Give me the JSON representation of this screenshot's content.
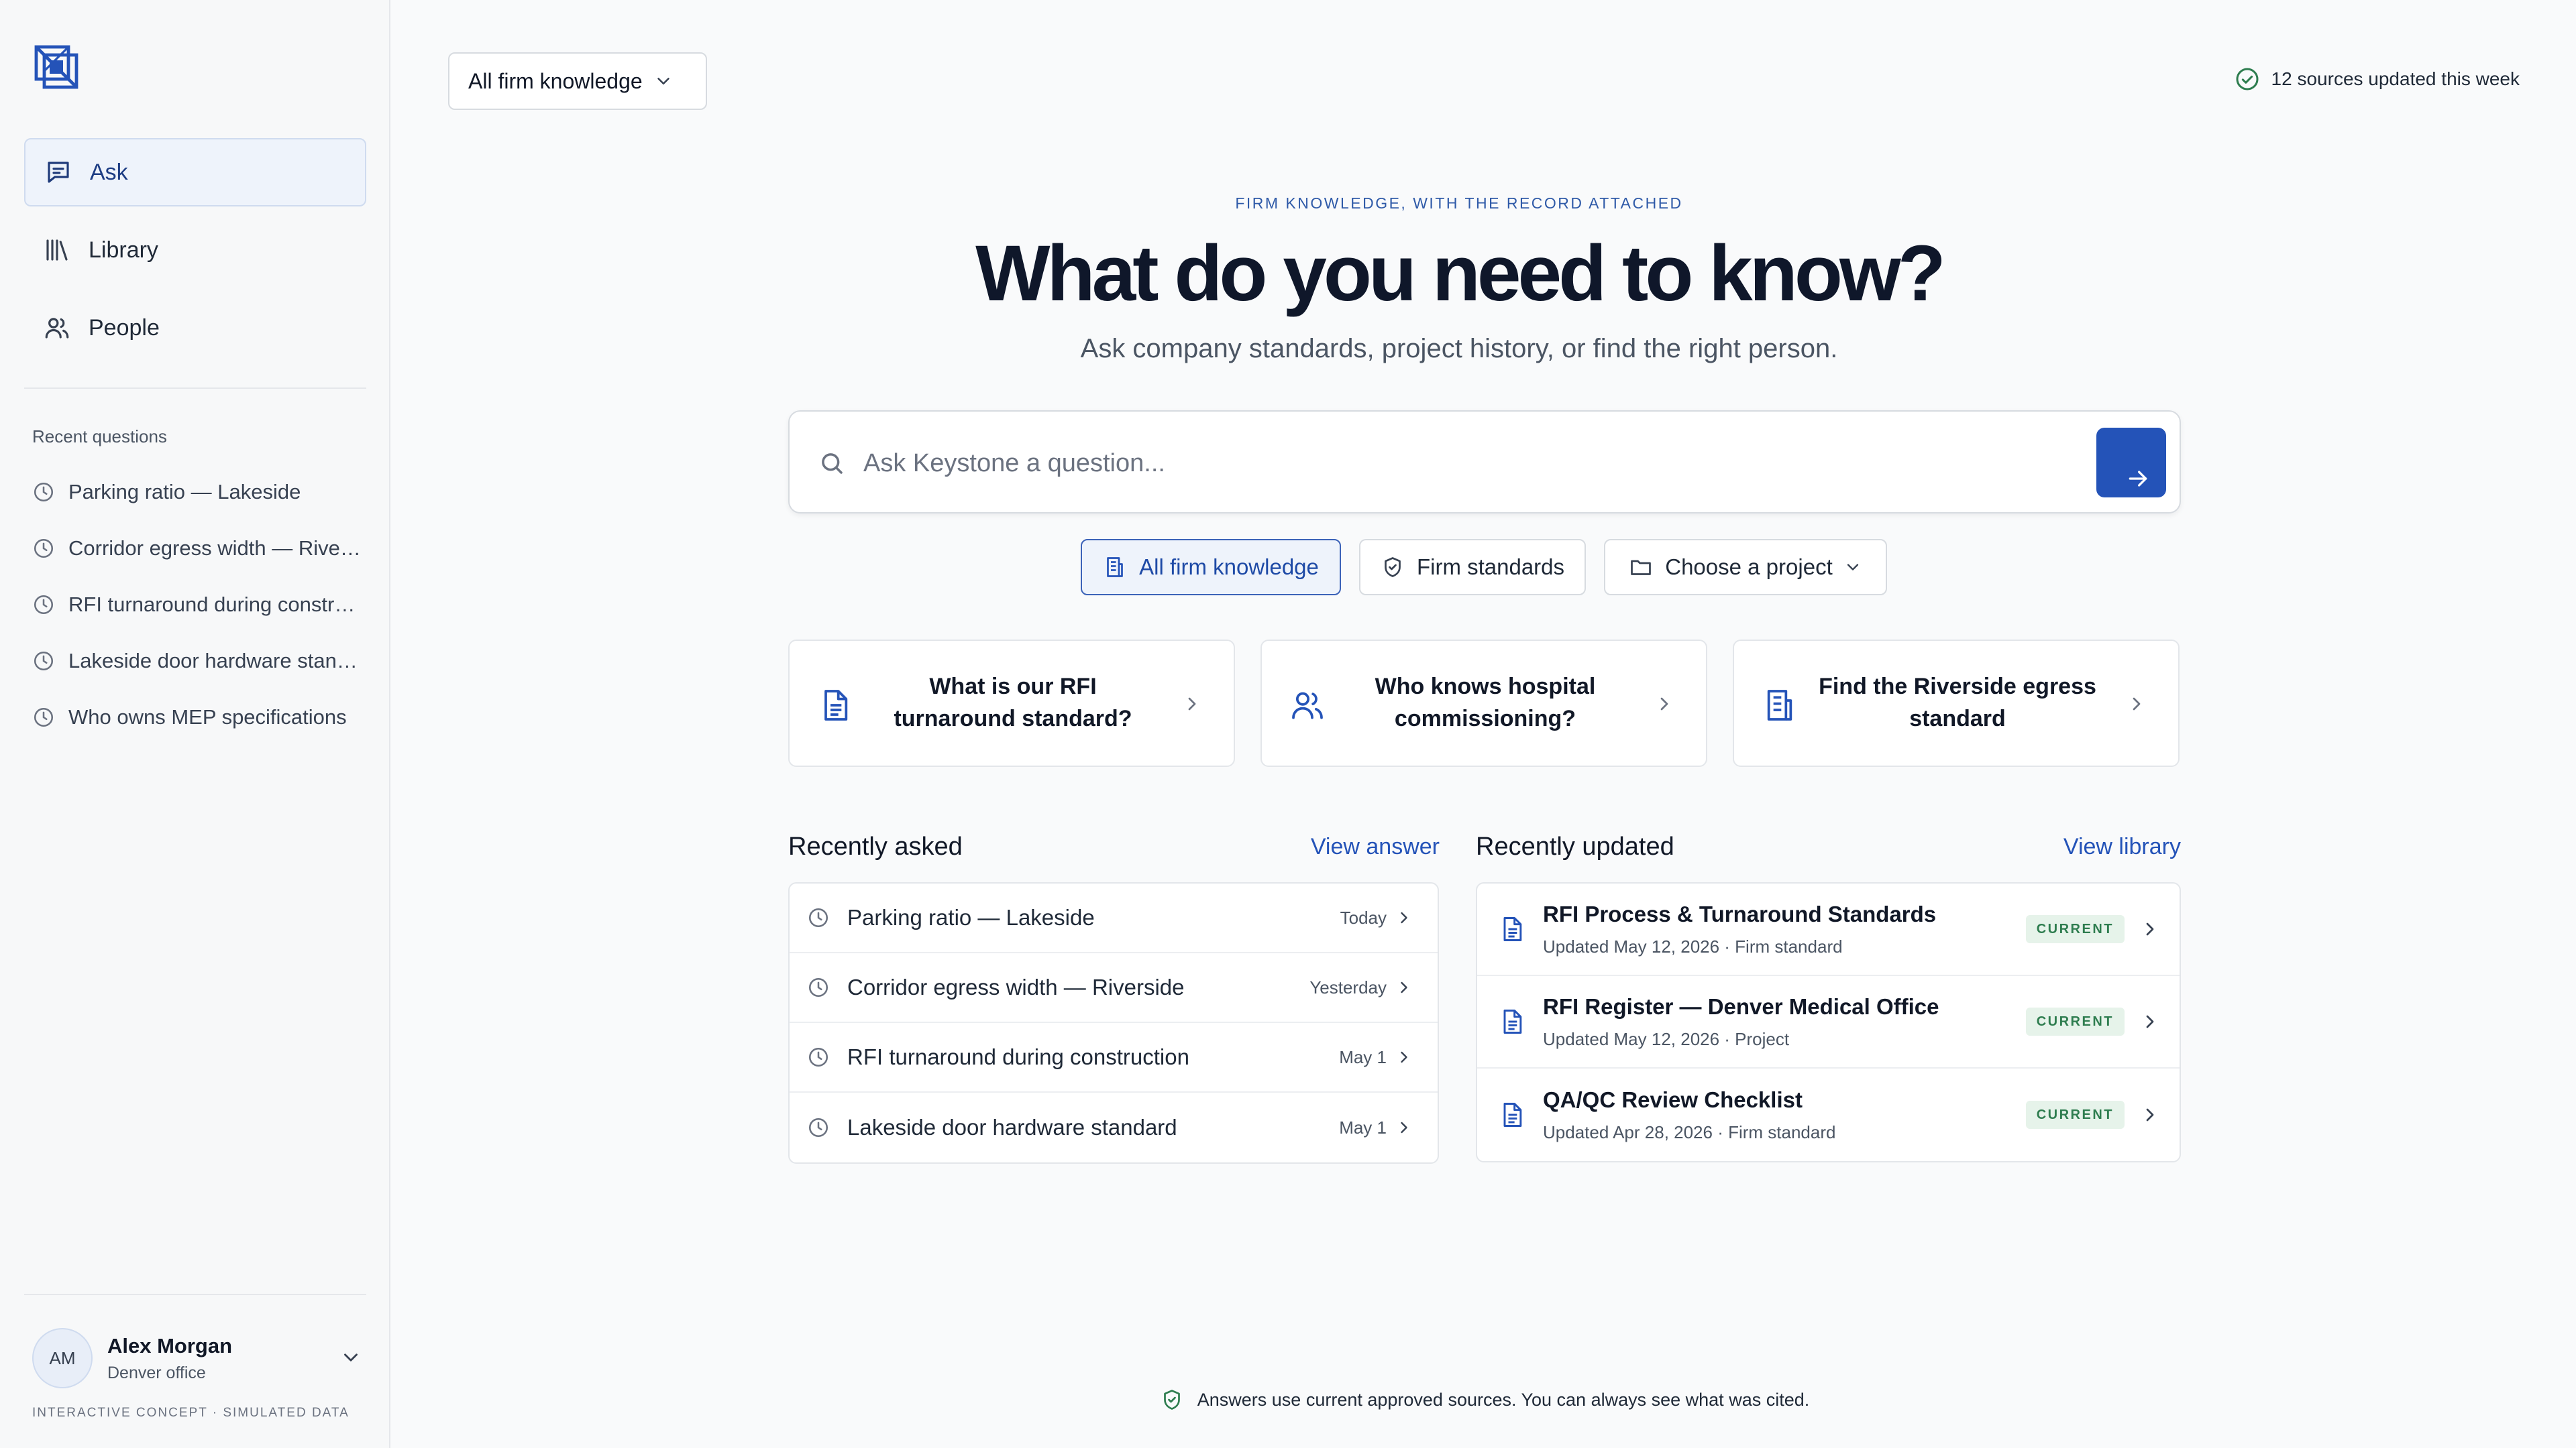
{
  "sidebar": {
    "nav": [
      {
        "label": "Ask",
        "icon": "chat-icon",
        "active": true
      },
      {
        "label": "Library",
        "icon": "library-icon",
        "active": false
      },
      {
        "label": "People",
        "icon": "people-icon",
        "active": false
      }
    ],
    "recent_title": "Recent questions",
    "recent": [
      "Parking ratio — Lakeside",
      "Corridor egress width — Riverside",
      "RFI turnaround during construction",
      "Lakeside door hardware standard",
      "Who owns MEP specifications"
    ],
    "user": {
      "initials": "AM",
      "name": "Alex Morgan",
      "office": "Denver office"
    },
    "concept_note": "INTERACTIVE CONCEPT · SIMULATED DATA"
  },
  "topbar": {
    "scope_label": "All firm knowledge",
    "sources_status": "12 sources updated this week"
  },
  "hero": {
    "eyebrow": "FIRM KNOWLEDGE, WITH THE RECORD ATTACHED",
    "title": "What do you need to know?",
    "subtitle": "Ask company standards, project history, or find the right person."
  },
  "search": {
    "placeholder": "Ask Keystone a question..."
  },
  "filters": [
    {
      "label": "All firm knowledge",
      "icon": "building-icon",
      "active": true
    },
    {
      "label": "Firm standards",
      "icon": "shield-icon",
      "active": false
    },
    {
      "label": "Choose a project",
      "icon": "folder-icon",
      "active": false
    }
  ],
  "suggestions": [
    {
      "label": "What is our RFI turnaround standard?",
      "icon": "document-icon"
    },
    {
      "label": "Who knows hospital commissioning?",
      "icon": "people-icon"
    },
    {
      "label": "Find the Riverside egress standard",
      "icon": "building-icon"
    }
  ],
  "recently_asked": {
    "title": "Recently asked",
    "link": "View answer",
    "items": [
      {
        "q": "Parking ratio — Lakeside",
        "date": "Today"
      },
      {
        "q": "Corridor egress width — Riverside",
        "date": "Yesterday"
      },
      {
        "q": "RFI turnaround during construction",
        "date": "May 1"
      },
      {
        "q": "Lakeside door hardware standard",
        "date": "May 1"
      }
    ]
  },
  "recently_updated": {
    "title": "Recently updated",
    "link": "View library",
    "items": [
      {
        "title": "RFI Process & Turnaround Standards",
        "meta": "Updated May 12, 2026 · Firm standard",
        "badge": "CURRENT"
      },
      {
        "title": "RFI Register — Denver Medical Office",
        "meta": "Updated May 12, 2026 · Project",
        "badge": "CURRENT"
      },
      {
        "title": "QA/QC Review Checklist",
        "meta": "Updated Apr 28, 2026 · Firm standard",
        "badge": "CURRENT"
      }
    ]
  },
  "footer": {
    "note": "Answers use current approved sources. You can always see what was cited."
  },
  "colors": {
    "accent": "#2453b8",
    "success": "#2e7d4f",
    "active_bg": "#eef3fb"
  }
}
